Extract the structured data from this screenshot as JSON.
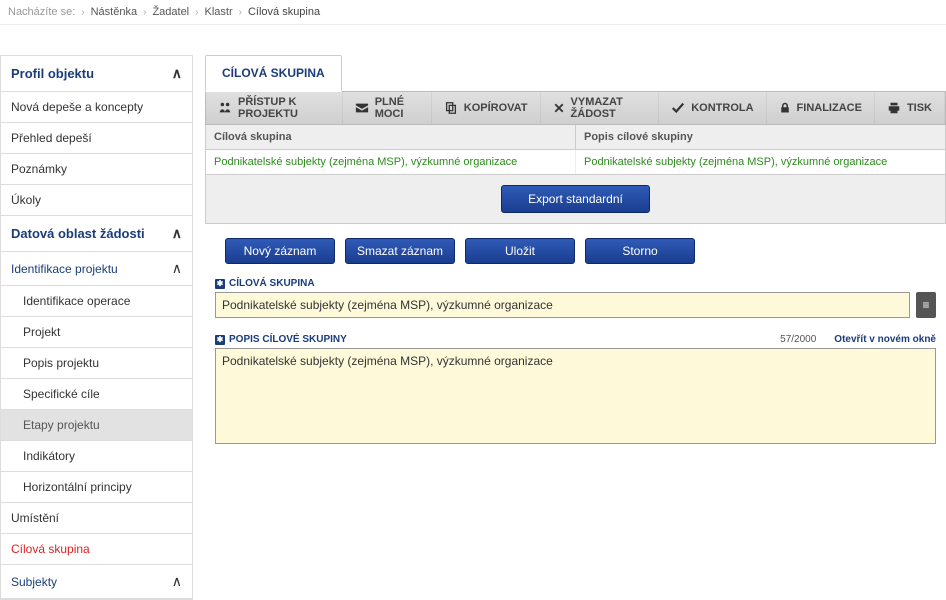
{
  "breadcrumb": {
    "label": "Nacházíte se:",
    "items": [
      "Nástěnka",
      "Žadatel",
      "Klastr",
      "Cílová skupina"
    ]
  },
  "sidebar": {
    "profile_header": "Profil objektu",
    "profile_items": [
      "Nová depeše a koncepty",
      "Přehled depeší",
      "Poznámky",
      "Úkoly"
    ],
    "data_header": "Datová oblast žádosti",
    "ident_header": "Identifikace projektu",
    "ident_items": [
      {
        "label": "Identifikace operace",
        "active": false
      },
      {
        "label": "Projekt",
        "active": false
      },
      {
        "label": "Popis projektu",
        "active": false
      },
      {
        "label": "Specifické cíle",
        "active": false
      },
      {
        "label": "Etapy projektu",
        "active": true
      },
      {
        "label": "Indikátory",
        "active": false
      },
      {
        "label": "Horizontální principy",
        "active": false
      }
    ],
    "umisteni": "Umístění",
    "cilova": "Cílová skupina",
    "subjekty_header": "Subjekty"
  },
  "tab": {
    "label": "CÍLOVÁ SKUPINA"
  },
  "toolbar": {
    "access": "PŘÍSTUP K PROJEKTU",
    "fullpower": "PLNÉ MOCI",
    "copy": "KOPÍROVAT",
    "delete": "VYMAZAT ŽÁDOST",
    "check": "KONTROLA",
    "finalize": "FINALIZACE",
    "print": "TISK"
  },
  "table": {
    "headers": [
      "Cílová skupina",
      "Popis cílové skupiny"
    ],
    "row": [
      "Podnikatelské subjekty (zejména MSP), výzkumné organizace",
      "Podnikatelské subjekty (zejména MSP), výzkumné organizace"
    ]
  },
  "buttons": {
    "export": "Export standardní",
    "new": "Nový záznam",
    "delete": "Smazat záznam",
    "save": "Uložit",
    "cancel": "Storno"
  },
  "form": {
    "field1_label": "CÍLOVÁ SKUPINA",
    "field1_value": "Podnikatelské subjekty (zejména MSP), výzkumné organizace",
    "field2_label": "POPIS CÍLOVÉ SKUPINY",
    "field2_value": "Podnikatelské subjekty (zejména MSP), výzkumné organizace",
    "counter": "57/2000",
    "open_link": "Otevřít v novém okně"
  }
}
